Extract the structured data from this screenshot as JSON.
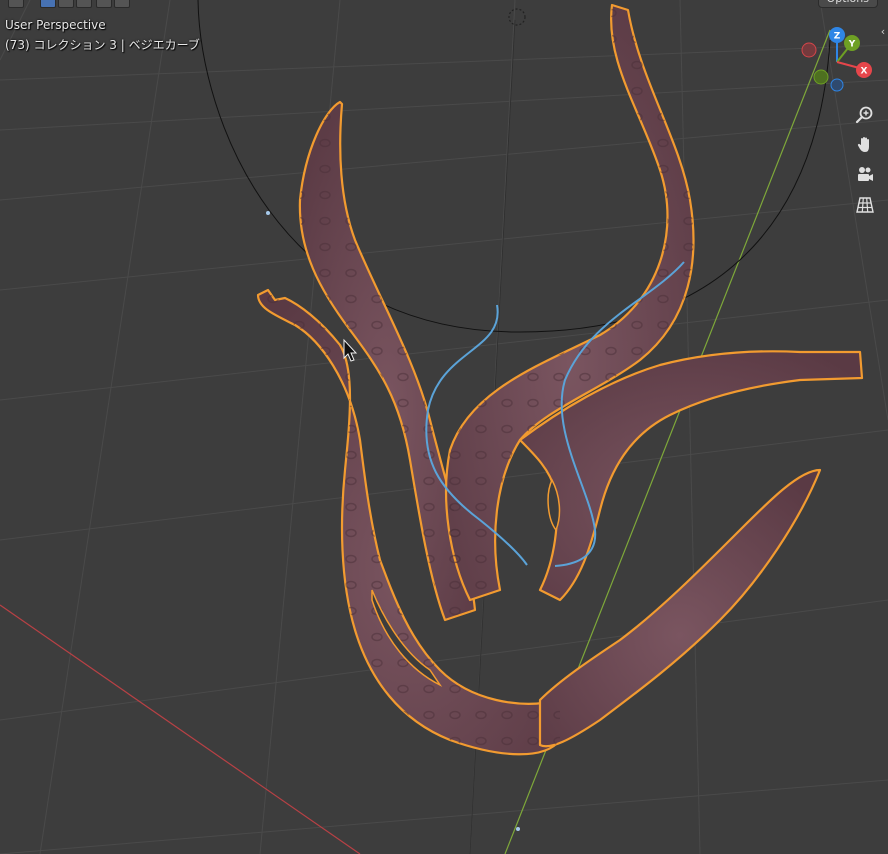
{
  "viewport": {
    "view_name": "User Perspective",
    "view_info": "(73) コレクション 3 | ベジエカーブ",
    "options_label": "Options",
    "sidebar_toggle_glyph": "‹"
  },
  "gizmo": {
    "z_label": "Z",
    "y_label": "Y",
    "x_label": "X",
    "x_color": "#e6464b",
    "y_color": "#6ea024",
    "z_color": "#2f86e6"
  },
  "navigation": [
    {
      "name": "zoom",
      "icon": "magnifier-plus-icon"
    },
    {
      "name": "pan",
      "icon": "hand-icon"
    },
    {
      "name": "camera",
      "icon": "camera-icon"
    },
    {
      "name": "projection",
      "icon": "grid-perspective-icon"
    }
  ],
  "colors": {
    "background": "#3d3d3d",
    "grid": "#4a4a4a",
    "selection_outline": "#f29b30",
    "mesh_fill": "#6b4550",
    "curve": "#5ba3d8",
    "x_axis_line": "#b84145",
    "y_axis_line": "#7ea83a"
  }
}
